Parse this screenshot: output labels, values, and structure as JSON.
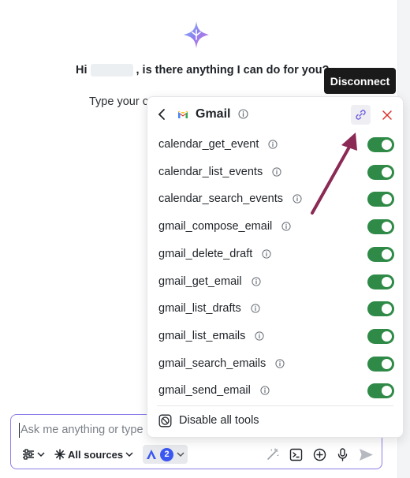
{
  "greeting": {
    "prefix": "Hi",
    "suffix": ", is there anything I can do for you?"
  },
  "hint_text": "Type your c",
  "popup": {
    "title": "Gmail",
    "tools": [
      {
        "name": "calendar_get_event",
        "enabled": true
      },
      {
        "name": "calendar_list_events",
        "enabled": true
      },
      {
        "name": "calendar_search_events",
        "enabled": true
      },
      {
        "name": "gmail_compose_email",
        "enabled": true
      },
      {
        "name": "gmail_delete_draft",
        "enabled": true
      },
      {
        "name": "gmail_get_email",
        "enabled": true
      },
      {
        "name": "gmail_list_drafts",
        "enabled": true
      },
      {
        "name": "gmail_list_emails",
        "enabled": true
      },
      {
        "name": "gmail_search_emails",
        "enabled": true
      },
      {
        "name": "gmail_send_email",
        "enabled": true
      }
    ],
    "disable_all_label": "Disable all tools",
    "toggle_color": "#2e8a46"
  },
  "tooltip": {
    "text": "Disconnect"
  },
  "composer": {
    "placeholder": "Ask me anything or type",
    "sources_label": "All sources",
    "app_count": "2",
    "accent": "#8b7fe8"
  },
  "annotation": {
    "arrow_color": "#8b2a55"
  }
}
